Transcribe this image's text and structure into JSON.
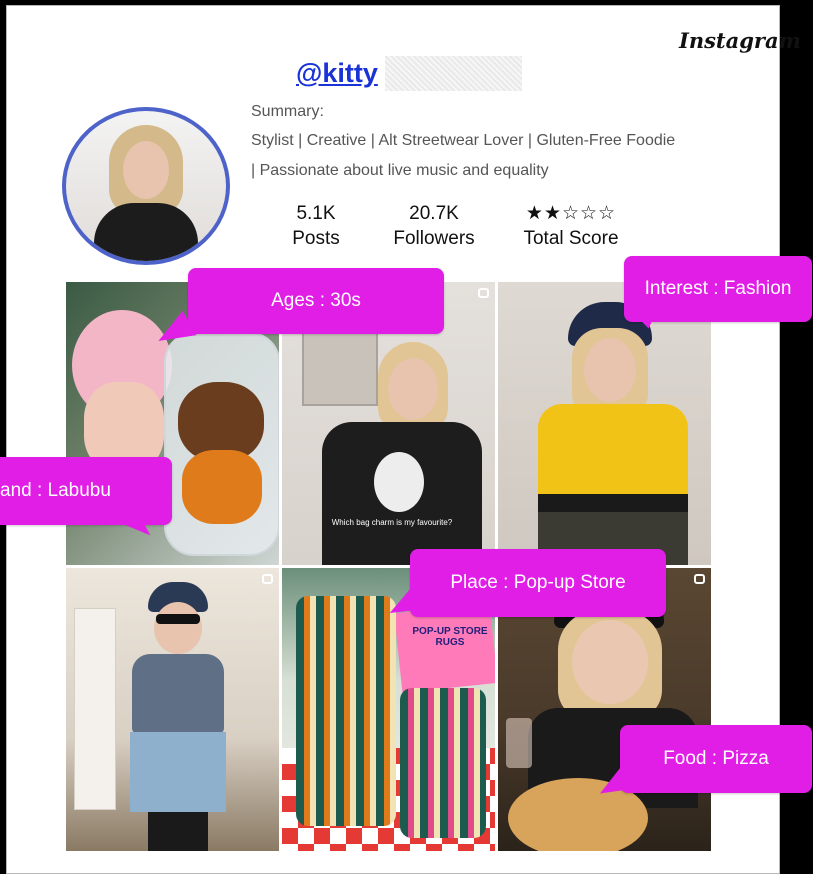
{
  "app": {
    "brand": "Instagram"
  },
  "profile": {
    "handle": "@kitty",
    "summary_label": "Summary:",
    "summary_lines": [
      "Stylist | Creative | Alt Streetwear Lover | Gluten-Free Foodie",
      "| Passionate about live music and equality"
    ],
    "stats": [
      {
        "value": "5.1K",
        "label": "Posts"
      },
      {
        "value": "20.7K",
        "label": "Followers"
      },
      {
        "value": "★★☆☆☆",
        "label": "Total Score"
      }
    ],
    "score_stars": 2
  },
  "tiles": [
    {
      "reel": false,
      "caption": ""
    },
    {
      "reel": true,
      "caption": "Which bag charm is my favourite?"
    },
    {
      "reel": false,
      "caption": ""
    },
    {
      "reel": true,
      "caption": ""
    },
    {
      "reel": false,
      "sign": "POP-UP STORE RUGS"
    },
    {
      "reel": true,
      "caption": ""
    }
  ],
  "callouts": {
    "ages": "Ages : 30s",
    "interest": "Interest : Fashion",
    "brand": "and : Labubu",
    "place": "Place : Pop-up Store",
    "food": "Food : Pizza"
  },
  "colors": {
    "callout": "#e11ee6",
    "handle": "#1a33d6",
    "avatar_ring": "#4d63c9"
  }
}
